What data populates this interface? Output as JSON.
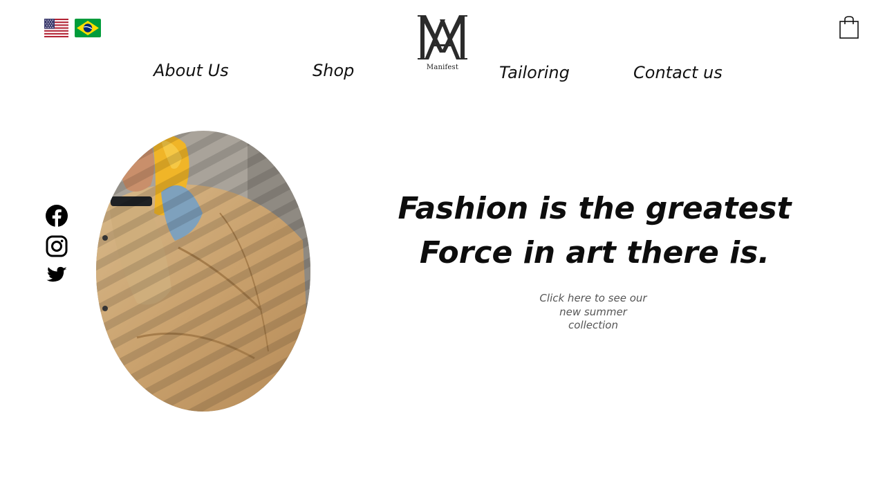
{
  "language_flags": [
    {
      "name": "us-flag-icon",
      "country": "United States"
    },
    {
      "name": "brazil-flag-icon",
      "country": "Brazil"
    }
  ],
  "brand": {
    "logo_letters": "MA",
    "wordmark": "Manifest"
  },
  "nav": {
    "items": [
      {
        "label": "About Us"
      },
      {
        "label": "Shop"
      },
      {
        "label": "Tailoring"
      },
      {
        "label": "Contact us"
      }
    ]
  },
  "cart": {
    "icon": "shopping-bag-icon"
  },
  "social": {
    "items": [
      {
        "icon": "facebook-icon"
      },
      {
        "icon": "instagram-icon"
      },
      {
        "icon": "twitter-icon"
      }
    ]
  },
  "hero": {
    "headline_line1": "Fashion is the greatest",
    "headline_line2": "Force in art there is.",
    "cta_lines": [
      "Click here to see our",
      "new summer",
      "collection"
    ],
    "image": "model-in-tan-corduroy-jacket-photo"
  },
  "colors": {
    "background": "#ffffff",
    "text": "#111111",
    "cta_text": "#555555",
    "brazil_green": "#009c3b",
    "brazil_yellow": "#ffdf00",
    "brazil_blue": "#002776",
    "us_red": "#b22234",
    "us_blue": "#3c3b6e"
  }
}
